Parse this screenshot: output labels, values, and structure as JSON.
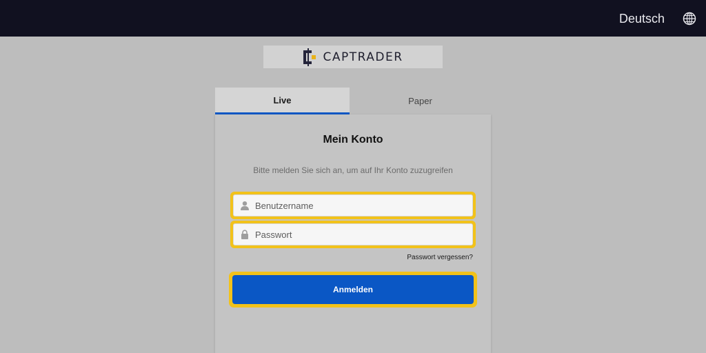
{
  "header": {
    "language_label": "Deutsch",
    "language_icon": "globe-icon"
  },
  "logo": {
    "text": "CAPTRADER",
    "mark_icon": "captrader-logo-mark"
  },
  "tabs": [
    {
      "label": "Live",
      "active": true
    },
    {
      "label": "Paper",
      "active": false
    }
  ],
  "login": {
    "title": "Mein Konto",
    "subtitle": "Bitte melden Sie sich an, um auf Ihr Konto zuzugreifen",
    "username": {
      "placeholder": "Benutzername",
      "value": "",
      "icon": "user-icon"
    },
    "password": {
      "placeholder": "Passwort",
      "value": "",
      "icon": "lock-icon"
    },
    "forgot_label": "Passwort vergessen?",
    "submit_label": "Anmelden"
  },
  "colors": {
    "topbar": "#111120",
    "accent_blue": "#0a57c5",
    "highlight_yellow": "#f2c21a",
    "page_bg": "#bdbdbd"
  }
}
